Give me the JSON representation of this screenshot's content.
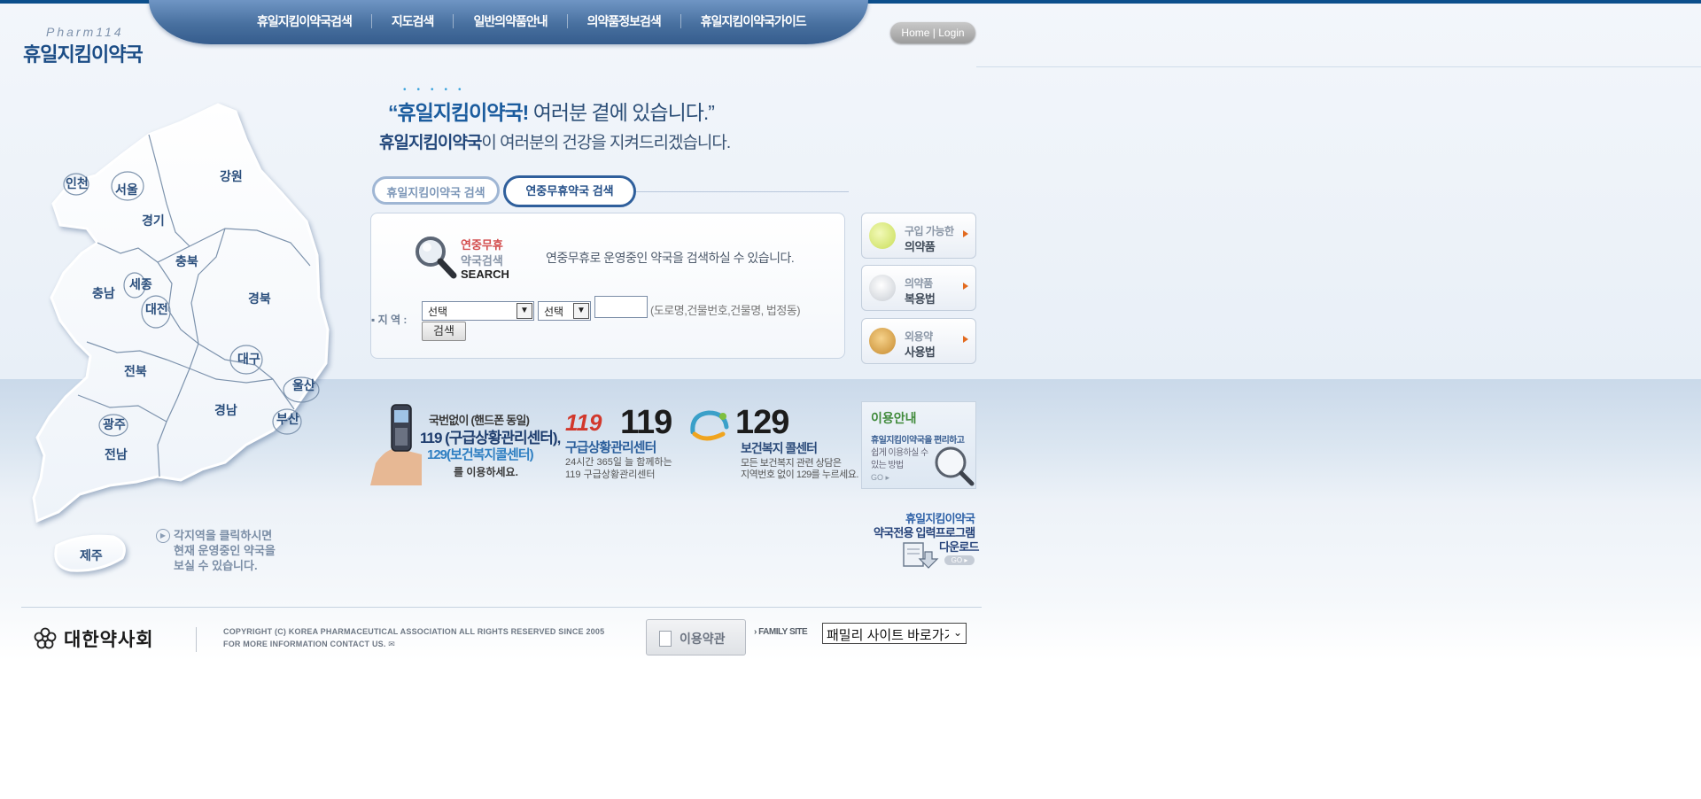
{
  "logo": {
    "sub": "Pharm114",
    "main": "휴일지킴이약국"
  },
  "nav": {
    "items": [
      "휴일지킴이약국검색",
      "지도검색",
      "일반의약품안내",
      "의약품정보검색",
      "휴일지킴이약국가이드"
    ],
    "home_login": "Home | Login"
  },
  "map": {
    "regions": [
      "인천",
      "서울",
      "경기",
      "강원",
      "충북",
      "충남",
      "세종",
      "대전",
      "경북",
      "대구",
      "전북",
      "울산",
      "경남",
      "부산",
      "광주",
      "전남",
      "제주"
    ],
    "hint_lines": [
      "각지역을 클릭하시면",
      "현재 운영중인 약국을",
      "보실 수 있습니다."
    ]
  },
  "headline": {
    "quote_brand": "“휴일지킴이약국",
    "quote_bang": "!",
    "quote_rest": "여러분 곁에 있습니다.”",
    "line2_brand": "휴일지킴이약국",
    "line2_rest": "이 여러분의 건강을 지켜드리겠습니다."
  },
  "tabs": {
    "tab1": "휴일지킴이약국 검색",
    "tab2": "연중무휴약국 검색"
  },
  "search": {
    "kw1": "연중무휴",
    "kw2": "약국검색",
    "kw3": "SEARCH",
    "desc": "연중무휴로 운영중인 약국을 검색하실 수 있습니다.",
    "region_label": "▪ 지 역 :",
    "select1_value": "선택",
    "select2_value": "선택",
    "input_hint": "(도로명,건물번호,건물명, 법정동)",
    "button": "검색"
  },
  "side_menu": [
    {
      "line1": "구입 가능한",
      "line2": "의약품"
    },
    {
      "line1": "의약품",
      "line2": "복용법"
    },
    {
      "line1": "외용약",
      "line2": "사용법"
    }
  ],
  "banner_phone": {
    "l1": "국번없이 (핸드폰 동일)",
    "l2": "119 (구급상황관리센터),",
    "l3": "129(보건복지콜센터)",
    "l4": "를 이용하세요."
  },
  "banner_119": {
    "logo": "119",
    "number": "119",
    "title": "구급상황관리센터",
    "sub1": "24시간 365일 늘 함께하는",
    "sub2": "119 구급상황관리센터"
  },
  "banner_129": {
    "number": "129",
    "title": "보건복지 콜센터",
    "sub1": "모든 보건복지 관련 상담은",
    "sub2": "지역번호 없이 129를 누르세요."
  },
  "guide": {
    "title": "이용안내",
    "l1": "휴일지킴이약국을 편리하고",
    "l2": "쉽게 이용하실 수",
    "l3": "있는 방법",
    "go": "GO ▸"
  },
  "download": {
    "l1": "휴일지킴이약국",
    "l2": "약국전용 입력프로그램",
    "l3": "다운로드",
    "go": "GO ▸"
  },
  "footer": {
    "org": "대한약사회",
    "copy1": "COPYRIGHT (C) KOREA PHARMACEUTICAL ASSOCIATION ALL RIGHTS RESERVED SINCE 2005",
    "copy2": "FOR MORE INFORMATION CONTACT US. ✉",
    "terms": "이용약관",
    "family_label": "› FAMILY SITE",
    "family_select": "패밀리 사이트 바로가기"
  }
}
